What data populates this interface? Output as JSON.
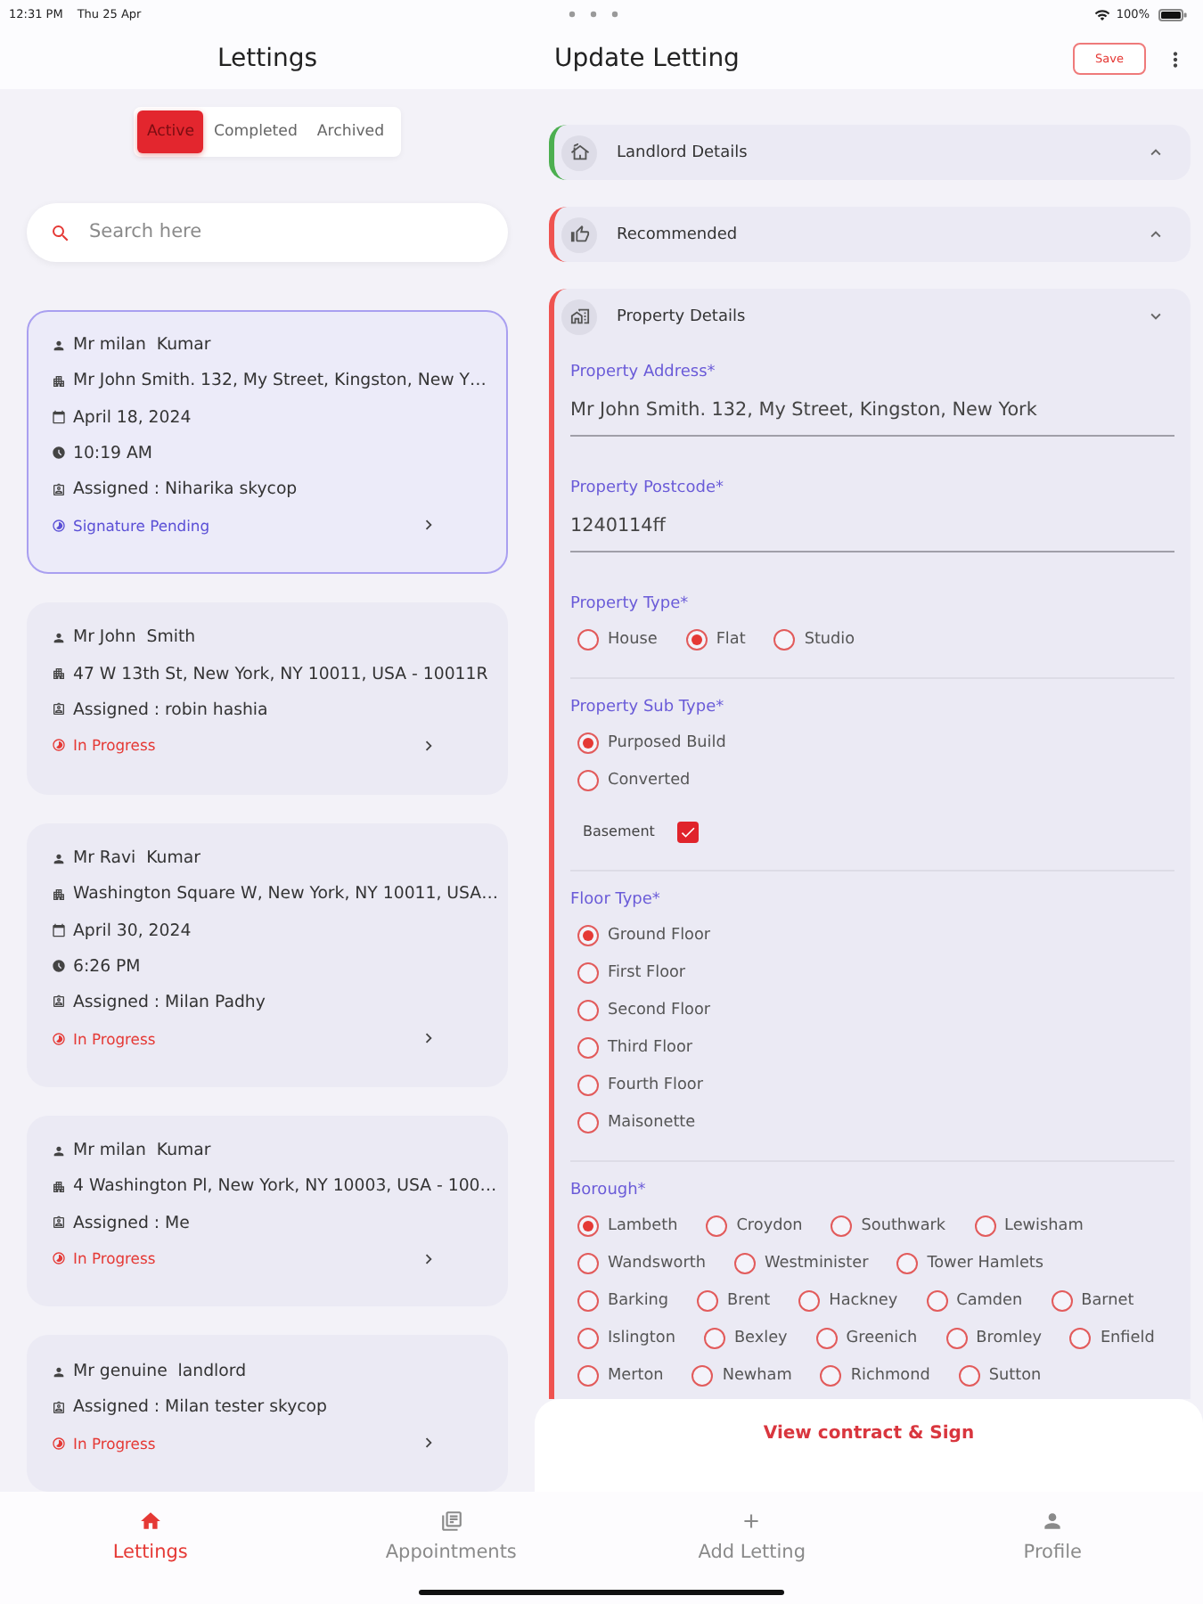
{
  "status_bar": {
    "time": "12:31 PM",
    "date": "Thu 25 Apr",
    "battery": "100%"
  },
  "lettings_panel": {
    "title": "Lettings",
    "tabs": [
      {
        "label": "Active",
        "selected": true
      },
      {
        "label": "Completed",
        "selected": false
      },
      {
        "label": "Archived",
        "selected": false
      }
    ],
    "search": {
      "placeholder": "Search here"
    },
    "cards": [
      {
        "selected": true,
        "rows": [
          {
            "kind": "name",
            "text": "Mr milan  Kumar"
          },
          {
            "kind": "address",
            "text": "Mr John Smith. 132, My Street, Kingston, New Y…"
          },
          {
            "kind": "date",
            "text": "April 18, 2024"
          },
          {
            "kind": "time",
            "text": "10:19 AM"
          },
          {
            "kind": "assignee",
            "text": "Assigned : Niharika skycop"
          }
        ],
        "status": {
          "kind": "pending",
          "text": "Signature Pending"
        }
      },
      {
        "selected": false,
        "rows": [
          {
            "kind": "name",
            "text": "Mr John  Smith"
          },
          {
            "kind": "address",
            "text": "47 W 13th St, New York, NY 10011, USA - 10011R"
          },
          {
            "kind": "assignee",
            "text": "Assigned : robin hashia"
          }
        ],
        "status": {
          "kind": "progress",
          "text": "In Progress"
        }
      },
      {
        "selected": false,
        "rows": [
          {
            "kind": "name",
            "text": "Mr Ravi  Kumar"
          },
          {
            "kind": "address",
            "text": "Washington Square W, New York, NY 10011, USA…"
          },
          {
            "kind": "date",
            "text": "April 30, 2024"
          },
          {
            "kind": "time",
            "text": "6:26 PM"
          },
          {
            "kind": "assignee",
            "text": "Assigned : Milan Padhy"
          }
        ],
        "status": {
          "kind": "progress",
          "text": "In Progress"
        }
      },
      {
        "selected": false,
        "rows": [
          {
            "kind": "name",
            "text": "Mr milan  Kumar"
          },
          {
            "kind": "address",
            "text": "4 Washington Pl, New York, NY 10003, USA - 100…"
          },
          {
            "kind": "assignee",
            "text": "Assigned : Me"
          }
        ],
        "status": {
          "kind": "progress",
          "text": "In Progress"
        }
      },
      {
        "selected": false,
        "rows": [
          {
            "kind": "name",
            "text": "Mr genuine  landlord"
          },
          {
            "kind": "assignee",
            "text": "Assigned : Milan tester skycop"
          }
        ],
        "status": {
          "kind": "progress",
          "text": "In Progress"
        }
      }
    ]
  },
  "update_panel": {
    "title": "Update Letting",
    "save_button": "Save",
    "sections": [
      {
        "title": "Landlord Details",
        "complete": true,
        "expanded": false
      },
      {
        "title": "Recommended",
        "complete": false,
        "expanded": false
      },
      {
        "title": "Property Details",
        "complete": false,
        "expanded": true,
        "fields": [
          {
            "kind": "text",
            "label": "Property Address*",
            "value": "Mr John Smith. 132, My Street, Kingston, New York"
          },
          {
            "kind": "text",
            "label": "Property Postcode*",
            "value": "1240114ff"
          },
          {
            "kind": "inline",
            "label": "Property Type*",
            "options": [
              {
                "label": "House",
                "selected": false
              },
              {
                "label": "Flat",
                "selected": true
              },
              {
                "label": "Studio",
                "selected": false
              }
            ]
          },
          {
            "kind": "stacked",
            "label": "Property Sub Type*",
            "options": [
              {
                "label": "Purposed Build",
                "selected": true
              },
              {
                "label": "Converted",
                "selected": false
              }
            ],
            "checkbox": {
              "label": "Basement",
              "checked": true
            }
          },
          {
            "kind": "stacked",
            "label": "Floor Type*",
            "options": [
              {
                "label": "Ground Floor",
                "selected": true
              },
              {
                "label": "First Floor",
                "selected": false
              },
              {
                "label": "Second Floor",
                "selected": false
              },
              {
                "label": "Third Floor",
                "selected": false
              },
              {
                "label": "Fourth Floor",
                "selected": false
              },
              {
                "label": "Maisonette",
                "selected": false
              }
            ]
          },
          {
            "kind": "inline",
            "label": "Borough*",
            "options": [
              {
                "label": "Lambeth",
                "selected": true
              },
              {
                "label": "Croydon",
                "selected": false
              },
              {
                "label": "Southwark",
                "selected": false
              },
              {
                "label": "Lewisham",
                "selected": false
              },
              {
                "label": "Wandsworth",
                "selected": false
              },
              {
                "label": "Westminister",
                "selected": false
              },
              {
                "label": "Tower Hamlets",
                "selected": false
              },
              {
                "label": "Barking",
                "selected": false
              },
              {
                "label": "Brent",
                "selected": false
              },
              {
                "label": "Hackney",
                "selected": false
              },
              {
                "label": "Camden",
                "selected": false
              },
              {
                "label": "Barnet",
                "selected": false
              },
              {
                "label": "Islington",
                "selected": false
              },
              {
                "label": "Bexley",
                "selected": false
              },
              {
                "label": "Greenich",
                "selected": false
              },
              {
                "label": "Bromley",
                "selected": false
              },
              {
                "label": "Enfield",
                "selected": false
              },
              {
                "label": "Merton",
                "selected": false
              },
              {
                "label": "Newham",
                "selected": false
              },
              {
                "label": "Richmond",
                "selected": false
              },
              {
                "label": "Sutton",
                "selected": false
              }
            ]
          }
        ]
      }
    ],
    "action": "View contract & Sign"
  },
  "bottom_nav": [
    {
      "label": "Lettings",
      "selected": true
    },
    {
      "label": "Appointments",
      "selected": false
    },
    {
      "label": "Add Letting",
      "selected": false
    },
    {
      "label": "Profile",
      "selected": false
    }
  ]
}
